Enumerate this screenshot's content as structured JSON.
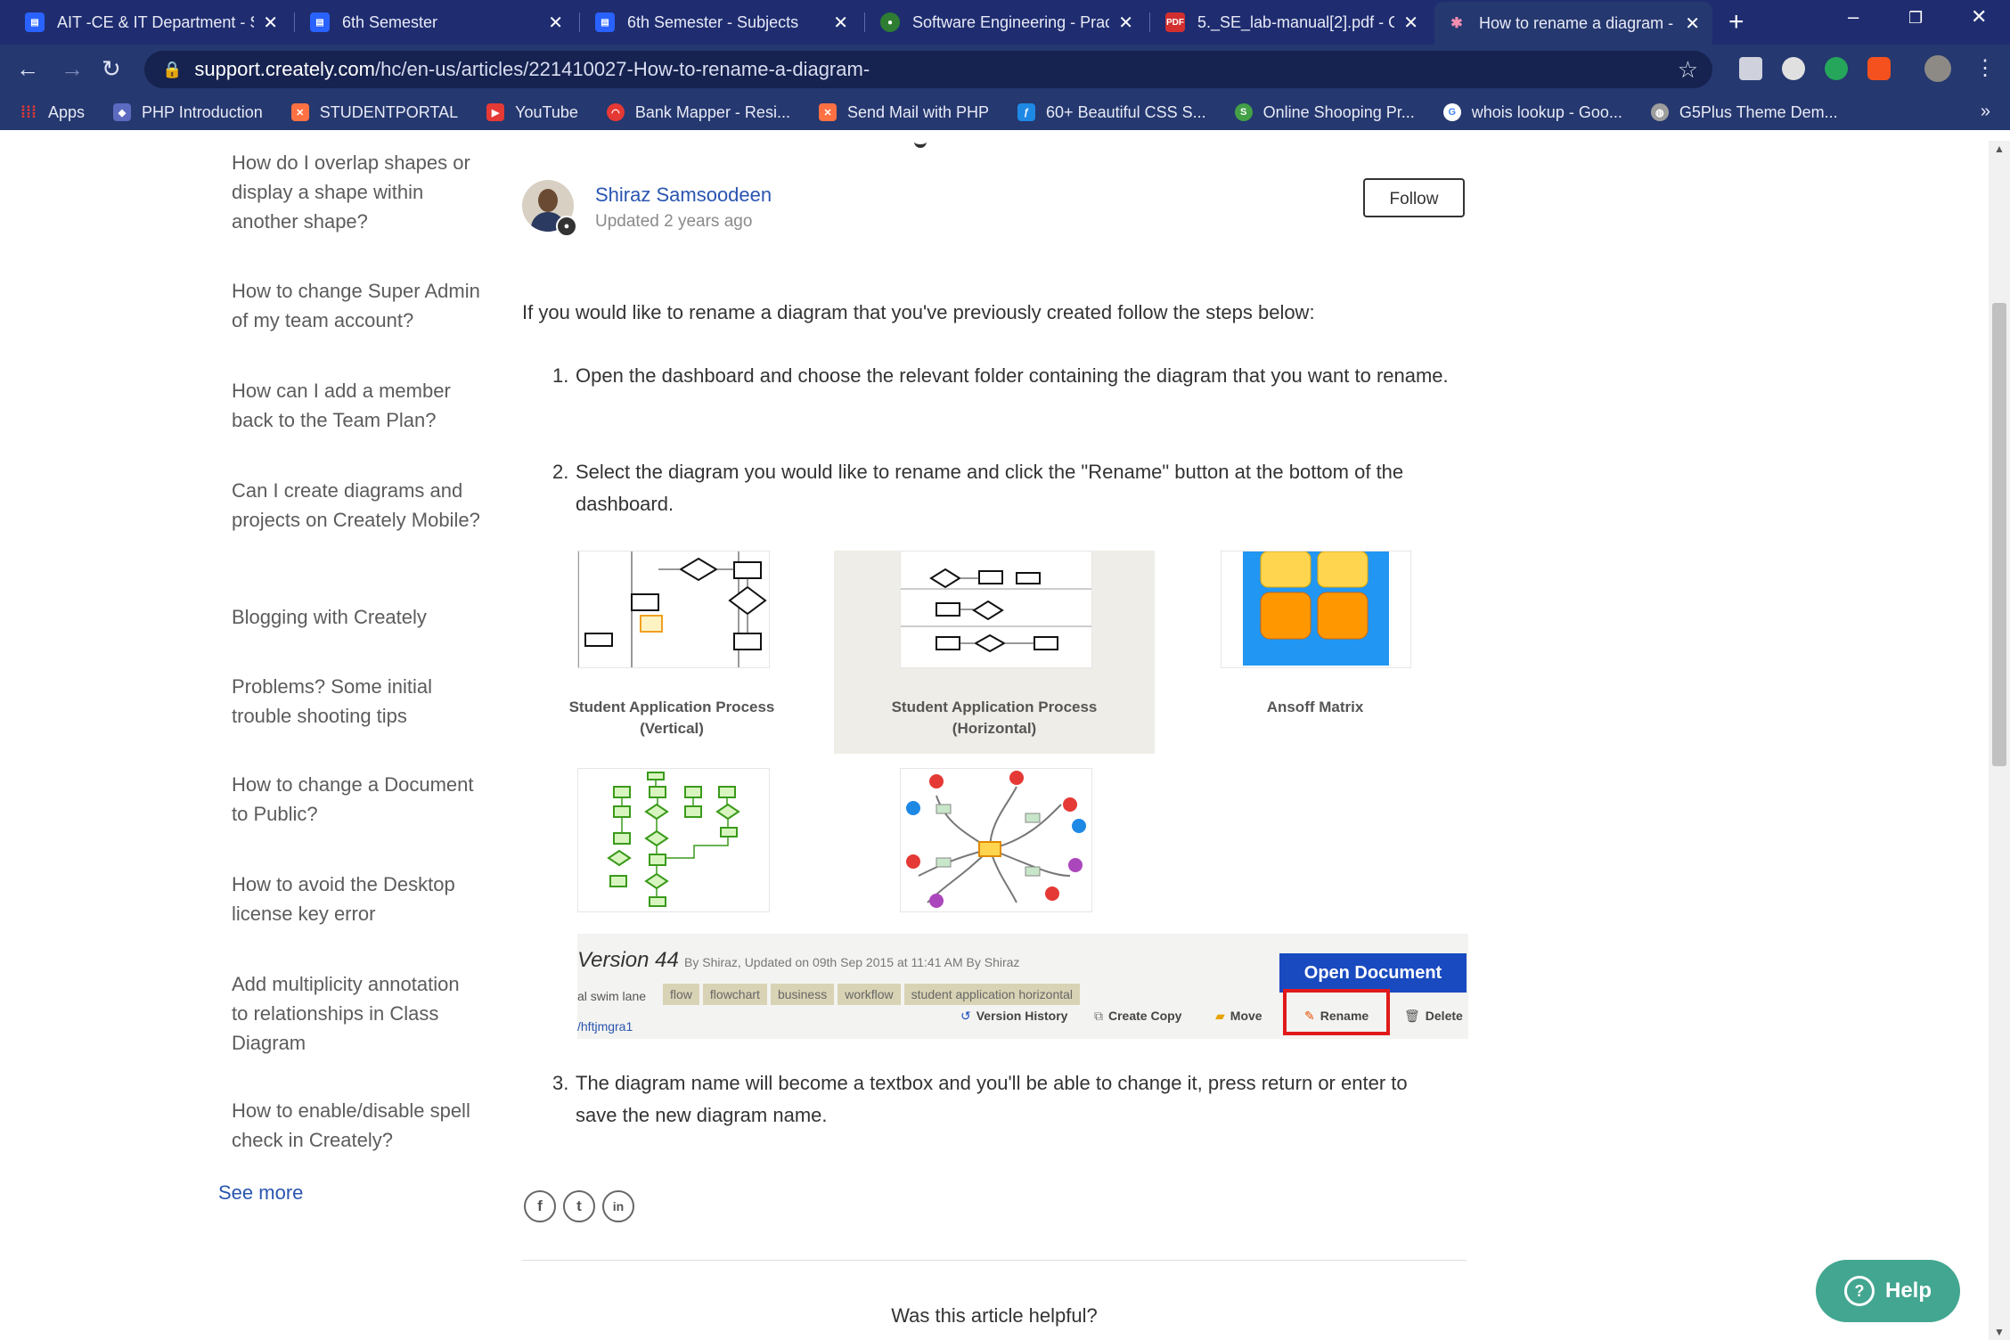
{
  "browser": {
    "tabs": [
      {
        "title": "AIT -CE & IT Department - S",
        "favicon": "doc-icon",
        "color": "#2962ff"
      },
      {
        "title": "6th Semester",
        "favicon": "doc-icon",
        "color": "#2962ff"
      },
      {
        "title": "6th Semester - Subjects",
        "favicon": "doc-icon",
        "color": "#2962ff"
      },
      {
        "title": "Software Engineering - Prac",
        "favicon": "site-icon",
        "color": "#2e7d32"
      },
      {
        "title": "5._SE_lab-manual[2].pdf - G",
        "favicon": "pdf-icon",
        "color": "#d32f2f"
      },
      {
        "title": "How to rename a diagram -",
        "favicon": "creately-icon",
        "color": "#25386f"
      }
    ],
    "pdf_badge": "PDF",
    "new_tab": "+",
    "url_host": "support.creately.com",
    "url_path": "/hc/en-us/articles/221410027-How-to-rename-a-diagram-",
    "bookmarks": [
      {
        "label": "Apps",
        "color": "#e53935"
      },
      {
        "label": "PHP Introduction",
        "color": "#5c6bc0"
      },
      {
        "label": "STUDENTPORTAL",
        "color": "#ff7043"
      },
      {
        "label": "YouTube",
        "color": "#e53935"
      },
      {
        "label": "Bank Mapper - Resi...",
        "color": "#e53935"
      },
      {
        "label": "Send Mail with PHP",
        "color": "#ff7043"
      },
      {
        "label": "60+ Beautiful CSS S...",
        "color": "#1e88e5"
      },
      {
        "label": "Online Shooping Pr...",
        "color": "#43a047"
      },
      {
        "label": "whois lookup - Goo...",
        "color": "#ffffff"
      },
      {
        "label": "G5Plus Theme Dem...",
        "color": "#9e9e9e"
      }
    ],
    "bookmarks_more": "»"
  },
  "sidebar": {
    "items": [
      "How do I overlap shapes or display a shape within another shape?",
      "How to change Super Admin of my team account?",
      "How can I add a member back to the Team Plan?",
      "Can I create diagrams and projects on Creately Mobile?",
      "Blogging with Creately",
      "Problems? Some initial trouble shooting tips",
      "How to change a Document to Public?",
      "How to avoid the Desktop license key error",
      "Add multiplicity annotation to relationships in Class Diagram",
      "How to enable/disable spell check in Creately?"
    ],
    "see_more": "See more"
  },
  "article": {
    "author": "Shiraz Samsoodeen",
    "updated": "Updated 2 years ago",
    "follow": "Follow",
    "intro": "If you would like to rename a diagram that you've previously created follow the steps below:",
    "steps": [
      {
        "num": "1.",
        "text": "Open the dashboard and choose the relevant folder containing the diagram that you want to rename."
      },
      {
        "num": "2.",
        "text": "Select the diagram you would like to rename and click the \"Rename\" button at the bottom of the dashboard."
      },
      {
        "num": "3.",
        "text": "The diagram name will become a textbox and you'll be able to change it, press return or enter to save the new diagram name."
      }
    ],
    "screenshot": {
      "tiles": [
        {
          "label": "Student Application Process (Vertical)"
        },
        {
          "label": "Student Application Process (Horizontal)"
        },
        {
          "label": "Ansoff Matrix"
        }
      ],
      "version_title": "Version 44",
      "version_meta": "By Shiraz, Updated on 09th Sep 2015 at 11:41 AM By Shiraz",
      "swim_lane": "al swim lane",
      "tags": [
        "flow",
        "flowchart",
        "business",
        "workflow",
        "student application horizontal"
      ],
      "link": "/hftjmgra1",
      "open_document": "Open Document",
      "actions": [
        "Version History",
        "Create Copy",
        "Move",
        "Rename",
        "Delete"
      ]
    },
    "share_icons": [
      "f",
      "t",
      "in"
    ],
    "helpful": "Was this article helpful?"
  },
  "help_button": "Help",
  "colors": {
    "accent": "#2a55b0",
    "help": "#43a690",
    "highlight": "#e01a1a",
    "chrome": "#25386f"
  }
}
